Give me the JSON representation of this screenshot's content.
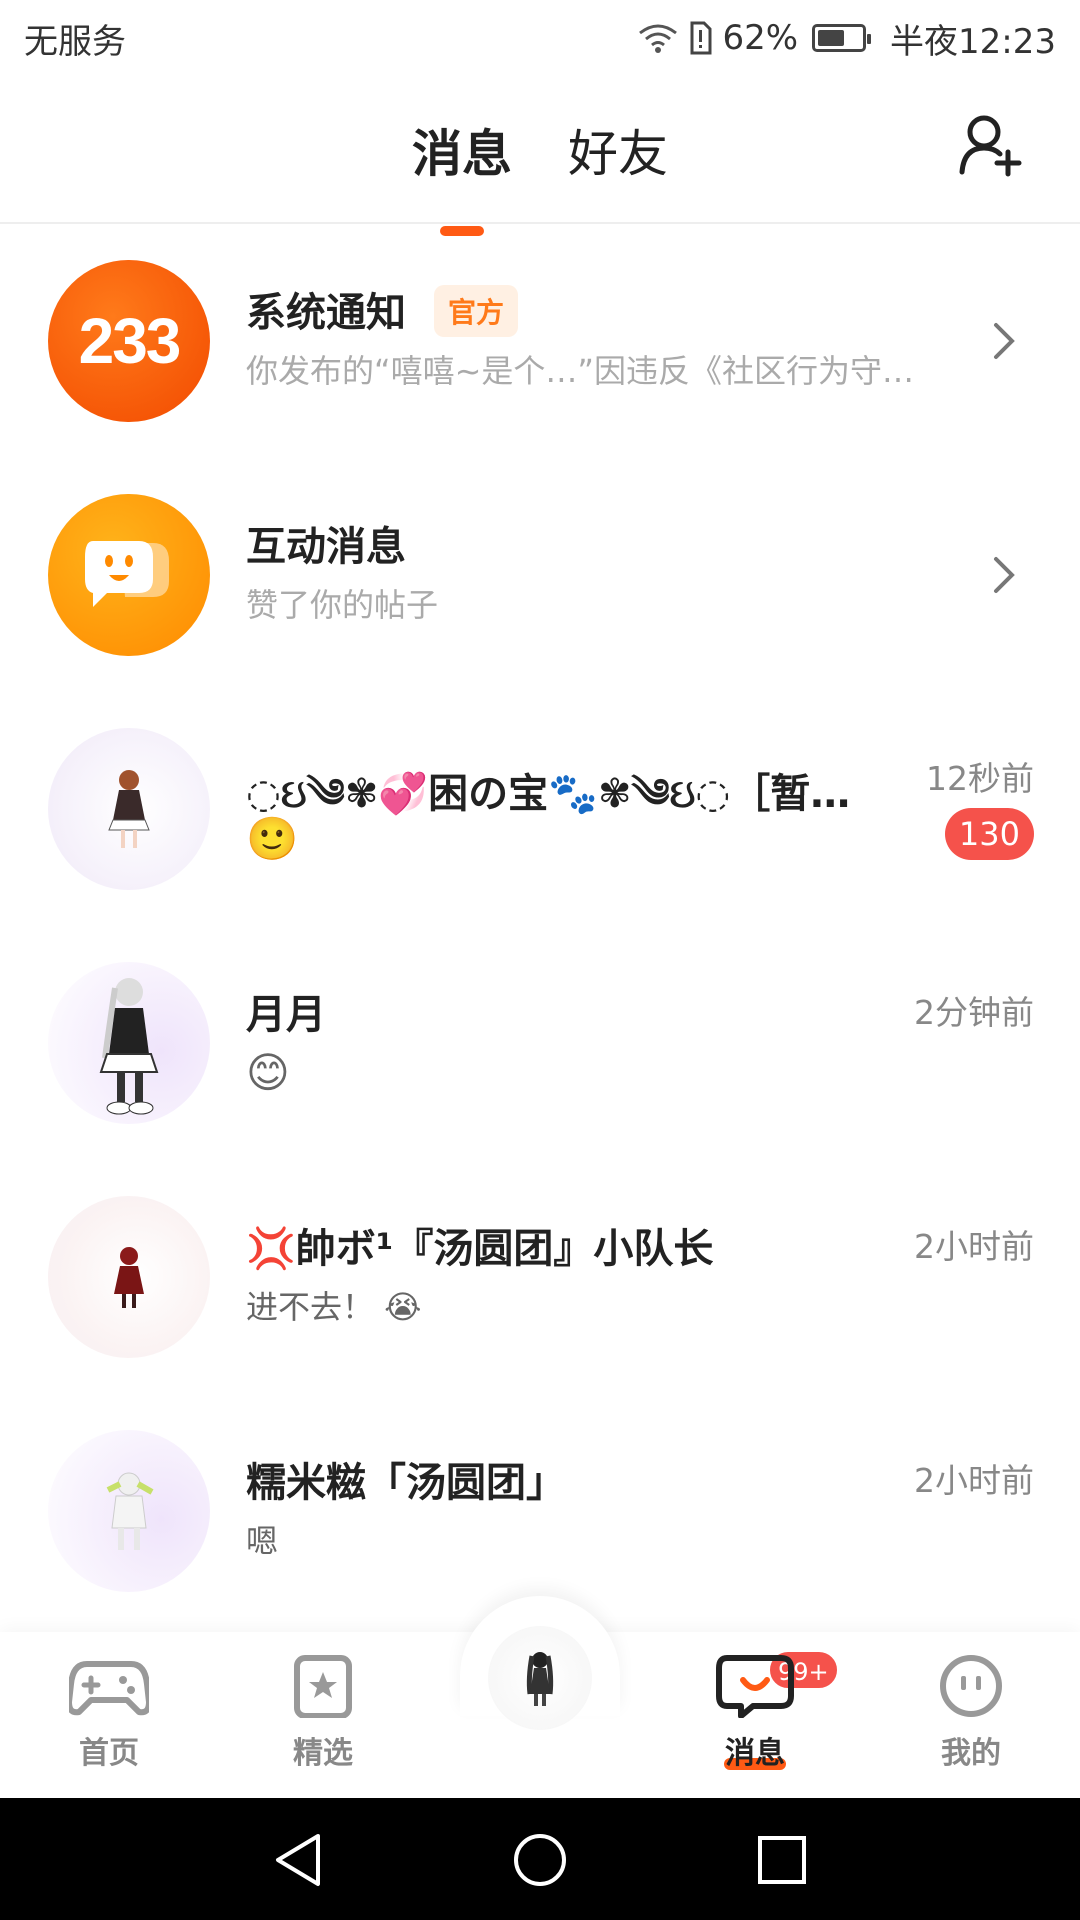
{
  "status_bar": {
    "carrier": "无服务",
    "battery_percent": "62%",
    "battery_level": 0.62,
    "time": "半夜12:23"
  },
  "header": {
    "tabs": [
      {
        "label": "消息",
        "active": true
      },
      {
        "label": "好友",
        "active": false
      }
    ],
    "add_friend_icon": "add-user-icon"
  },
  "conversations": [
    {
      "title": "系统通知",
      "badge": "官方",
      "subtitle": "你发布的“嘻嘻~是个…”因违反《社区行为守…",
      "avatar_text": "233",
      "chevron": true
    },
    {
      "title": "互动消息",
      "subtitle": "赞了你的帖子",
      "avatar_icon": "chat-smile-icon",
      "chevron": true
    },
    {
      "title": "◌ઇ༄✾💞困の宝🐾✾༄ઇ◌［暂…",
      "time": "12秒前",
      "subtitle": "🙂",
      "unread": "130"
    },
    {
      "title": "月月",
      "time": "2分钟前",
      "subtitle": "😊"
    },
    {
      "title": "💢帥ボ¹『汤圆团』小队长",
      "time": "2小时前",
      "subtitle": "进不去！ 😭"
    },
    {
      "title": "糯米糍「汤圆团」",
      "time": "2小时前",
      "subtitle": "嗯"
    }
  ],
  "bottom_nav": {
    "items": [
      {
        "label": "首页",
        "icon": "gamepad-icon"
      },
      {
        "label": "精选",
        "icon": "star-bookmark-icon"
      },
      {
        "label": "",
        "icon": "avatar-icon"
      },
      {
        "label": "消息",
        "icon": "chat-icon",
        "badge": "99+",
        "active": true
      },
      {
        "label": "我的",
        "icon": "face-icon"
      }
    ]
  },
  "colors": {
    "accent": "#ff5a14",
    "badge_red": "#f5524b",
    "official_badge_text": "#ff7a1a"
  }
}
